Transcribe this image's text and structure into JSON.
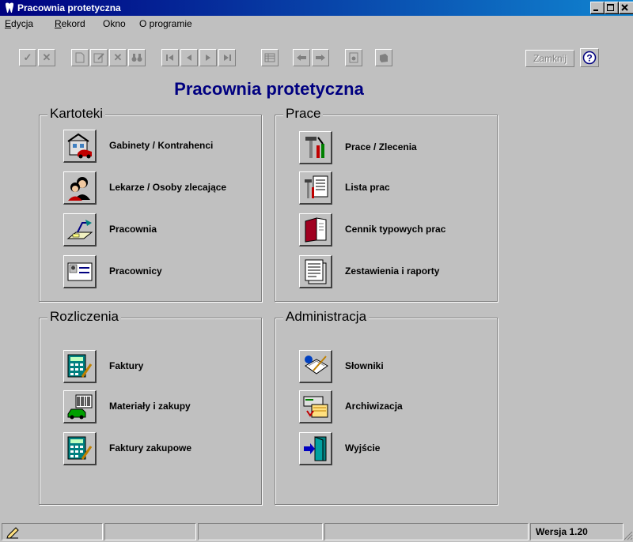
{
  "window": {
    "title": "Pracownia protetyczna"
  },
  "menu": [
    {
      "label_u": "E",
      "label_rest": "dycja"
    },
    {
      "label_u": "R",
      "label_rest": "ekord"
    },
    {
      "label_u": "",
      "label_rest": "Okno"
    },
    {
      "label_u": "",
      "label_rest": "O programie"
    }
  ],
  "toolbar": {
    "close_label": "Zamknij"
  },
  "heading": "Pracownia protetyczna",
  "groups": {
    "kartoteki": {
      "title": "Kartoteki",
      "items": [
        "Gabinety / Kontrahenci",
        "Lekarze / Osoby zlecające",
        "Pracownia",
        "Pracownicy"
      ]
    },
    "prace": {
      "title": "Prace",
      "items": [
        "Prace / Zlecenia",
        "Lista prac",
        "Cennik typowych prac",
        "Zestawienia i raporty"
      ]
    },
    "rozliczenia": {
      "title": "Rozliczenia",
      "items": [
        "Faktury",
        "Materiały i zakupy",
        "Faktury zakupowe"
      ]
    },
    "administracja": {
      "title": "Administracja",
      "items": [
        "Słowniki",
        "Archiwizacja",
        "Wyjście"
      ]
    }
  },
  "status": {
    "version": "Wersja 1.20"
  }
}
